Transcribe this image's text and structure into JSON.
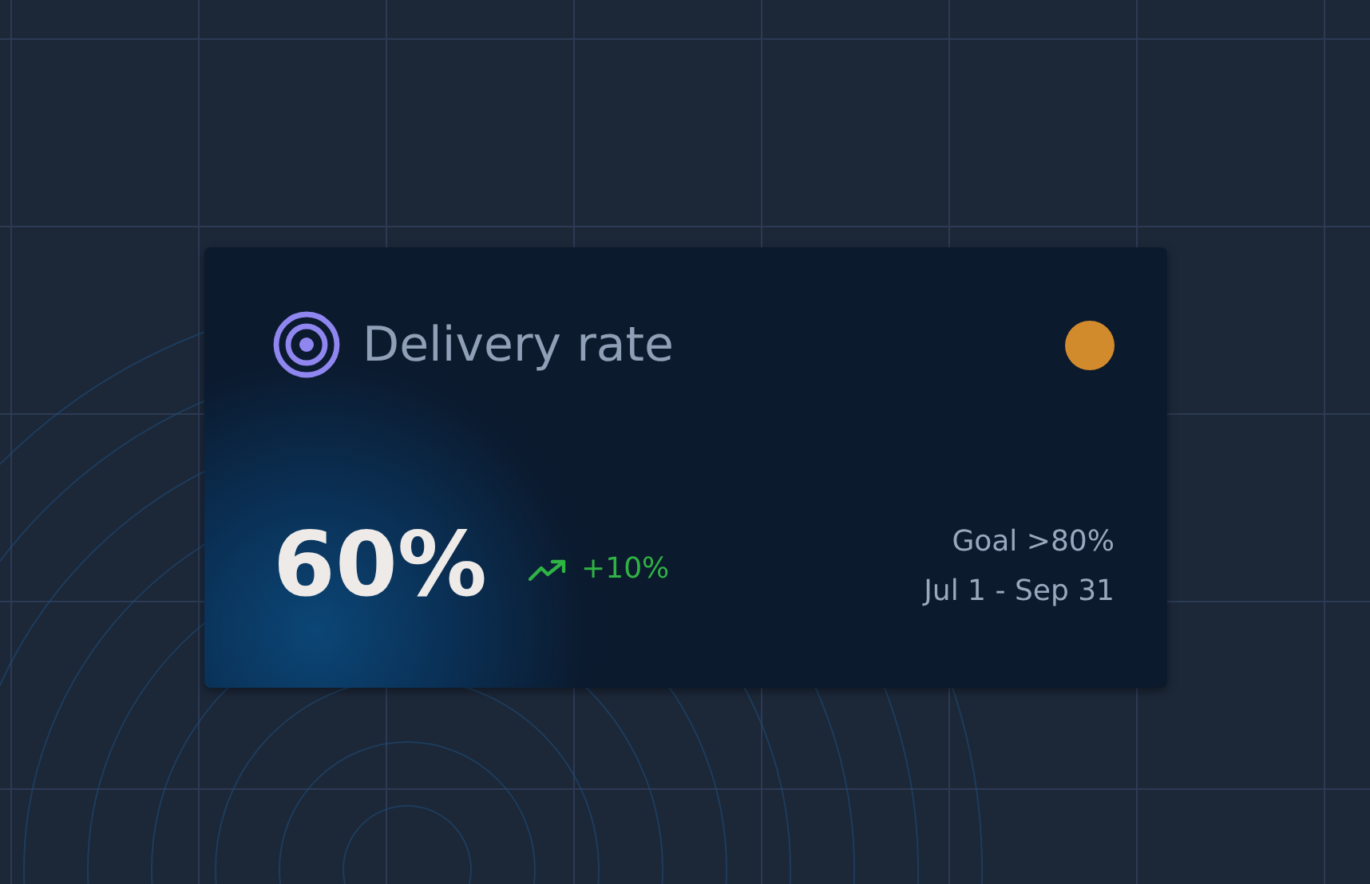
{
  "card": {
    "title": "Delivery rate",
    "status": {
      "color": "#d18b2c"
    },
    "value": "60%",
    "change": "+10%",
    "goal": "Goal >80%",
    "period": "Jul 1 - Sep 31"
  }
}
